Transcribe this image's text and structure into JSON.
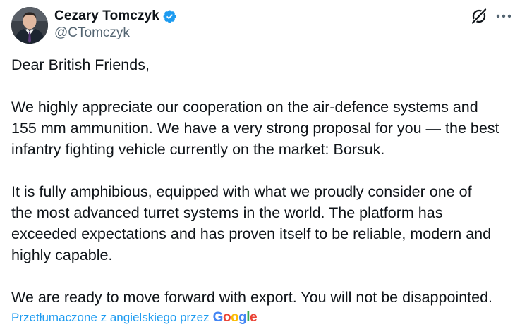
{
  "author": {
    "display_name": "Cezary Tomczyk",
    "handle": "@CTomczyk",
    "verified": true
  },
  "icons": {
    "avatar": "profile-photo",
    "verified": "verified-badge-icon",
    "grok": "grok-icon",
    "more": "more-options-icon"
  },
  "tweet": {
    "paragraphs": [
      {
        "lines": [
          "Dear British Friends,"
        ]
      },
      {
        "lines": [
          "We highly appreciate our cooperation on the air-defence systems and",
          "155 mm ammunition. We have a very strong proposal for you — the best",
          "infantry fighting vehicle currently on the market: Borsuk."
        ]
      },
      {
        "lines": [
          "It is fully amphibious, equipped with what we proudly consider one of",
          "the most advanced turret systems in the world. The platform has",
          "exceeded expectations and has proven itself to be reliable, modern and",
          "highly capable."
        ]
      },
      {
        "lines": [
          "We are ready to move forward with export. You will not be disappointed."
        ]
      }
    ]
  },
  "translation": {
    "label": "Przetłumaczone z angielskiego przez",
    "provider": "Google"
  },
  "colors": {
    "text": "#0f1419",
    "secondary": "#536471",
    "accent": "#1d9bf0"
  }
}
